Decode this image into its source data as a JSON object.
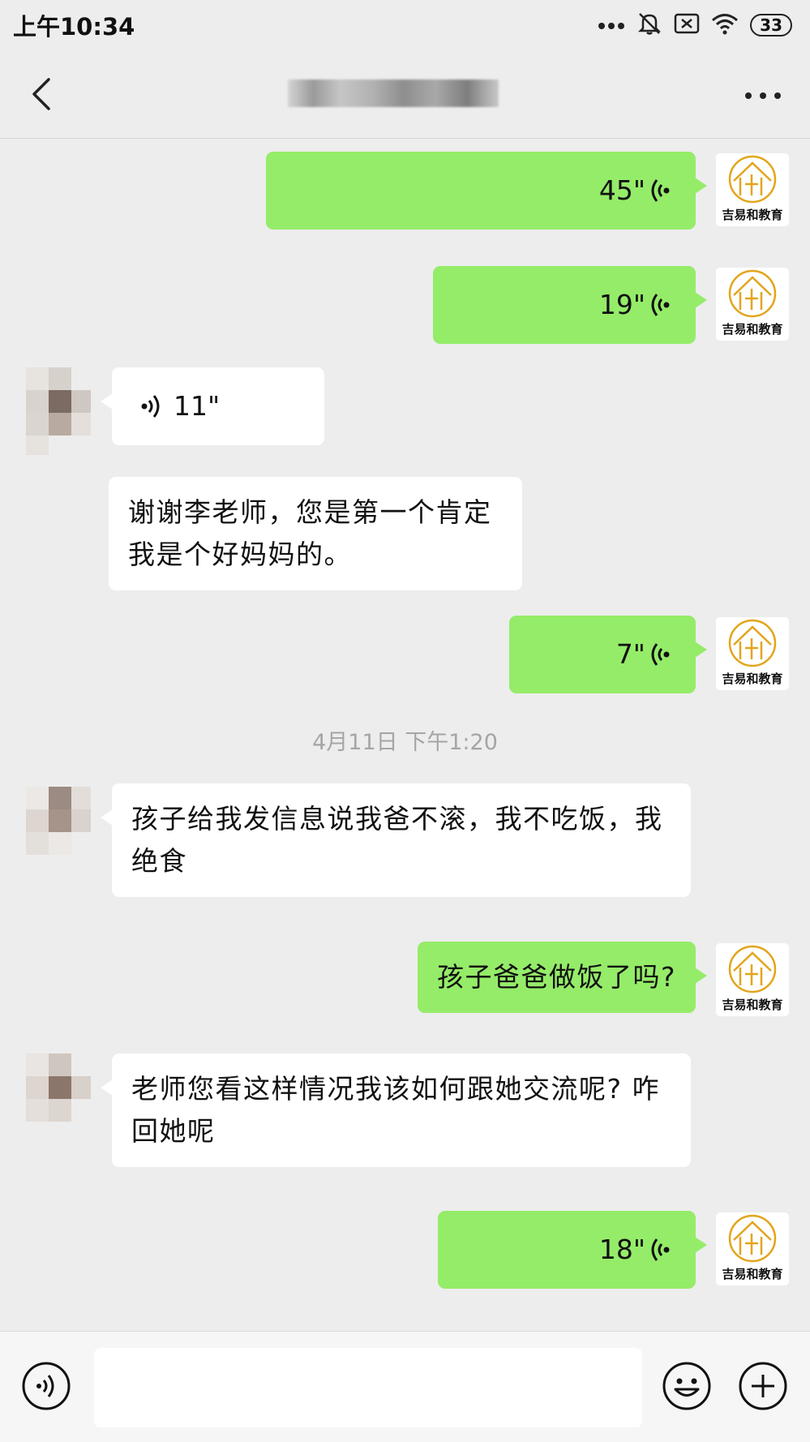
{
  "status_bar": {
    "time": "上午10:34",
    "battery": "33"
  },
  "header": {
    "title": "",
    "back_icon": "chevron-left-icon",
    "more_icon": "ellipsis-icon"
  },
  "brand_avatar_text": "吉易和教育",
  "messages": {
    "m1": {
      "sender": "me",
      "type": "voice",
      "duration": "45\""
    },
    "m2": {
      "sender": "me",
      "type": "voice",
      "duration": "19\""
    },
    "m3": {
      "sender": "other",
      "type": "voice",
      "duration": "11\""
    },
    "m4": {
      "sender": "other",
      "type": "text",
      "text": "谢谢李老师，您是第一个肯定我是个好妈妈的。"
    },
    "m5": {
      "sender": "me",
      "type": "voice",
      "duration": "7\""
    },
    "timestamp": "4月11日 下午1:20",
    "m6": {
      "sender": "other",
      "type": "text",
      "text": "孩子给我发信息说我爸不滚，我不吃饭，我绝食"
    },
    "m7": {
      "sender": "me",
      "type": "text",
      "text": "孩子爸爸做饭了吗?"
    },
    "m8": {
      "sender": "other",
      "type": "text",
      "text": "老师您看这样情况我该如何跟她交流呢? 咋回她呢"
    },
    "m9": {
      "sender": "me",
      "type": "voice",
      "duration": "18\""
    }
  },
  "input_bar": {
    "voice_icon": "voice-toggle-icon",
    "emoji_icon": "smiley-icon",
    "plus_icon": "plus-circle-icon",
    "message_value": ""
  },
  "colors": {
    "my_bubble": "#95ec69",
    "other_bubble": "#ffffff",
    "background": "#ededed",
    "brand_gold": "#e2a51b"
  }
}
